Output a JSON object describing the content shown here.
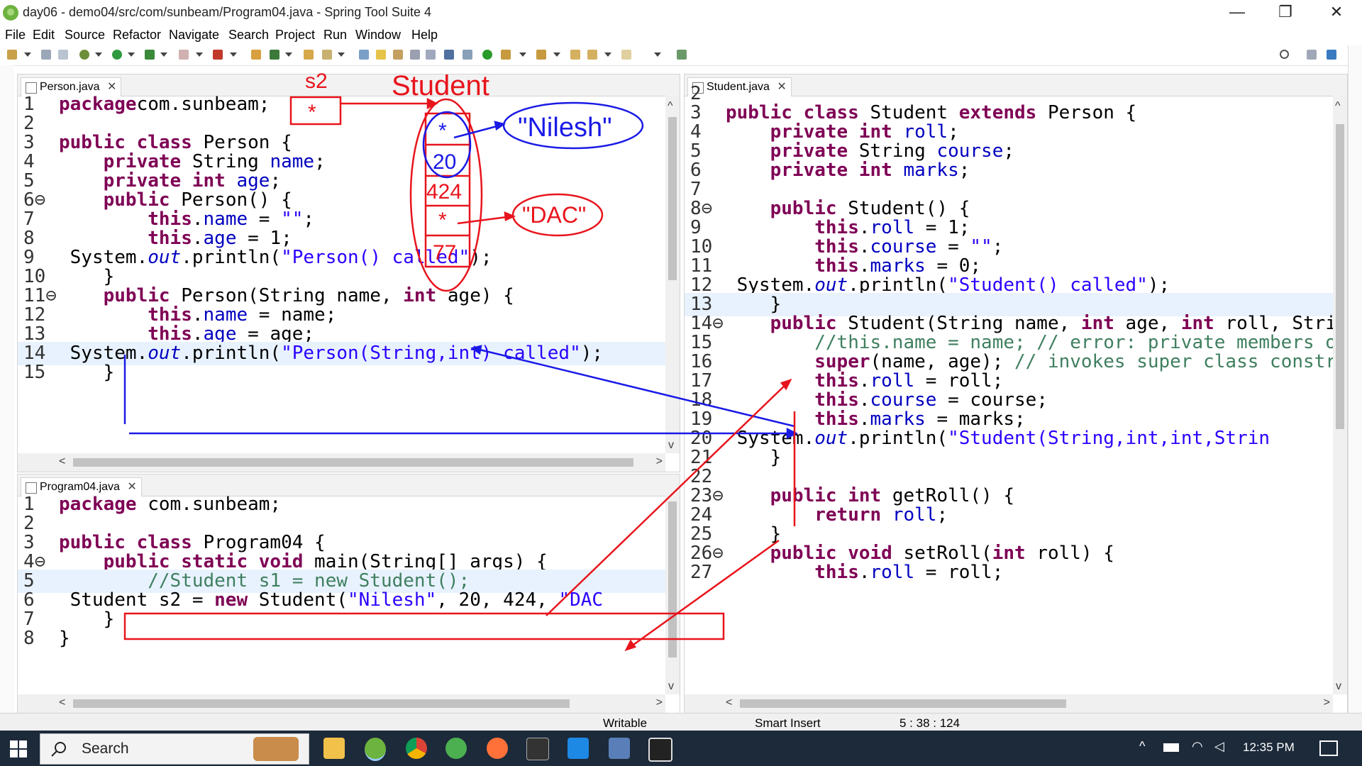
{
  "window": {
    "title": "day06 - demo04/src/com/sunbeam/Program04.java - Spring Tool Suite 4",
    "minimize": "—",
    "maximize": "❐",
    "close": "✕"
  },
  "menu": [
    "File",
    "Edit",
    "Source",
    "Refactor",
    "Navigate",
    "Search",
    "Project",
    "Run",
    "Window",
    "Help"
  ],
  "editors": {
    "person": {
      "tab": "Person.java",
      "close": "✕",
      "lines": [
        {
          "n": "1",
          "t": [
            [
              "kw",
              "package"
            ],
            [
              "",
              "com.sunbeam;"
            ]
          ]
        },
        {
          "n": "2",
          "t": []
        },
        {
          "n": "3",
          "t": [
            [
              "kw",
              "public class"
            ],
            [
              "",
              " Person {"
            ]
          ]
        },
        {
          "n": "4",
          "t": [
            [
              "",
              " "
            ],
            [
              "kw",
              "private"
            ],
            [
              "",
              " String "
            ],
            [
              "fld",
              "name"
            ],
            [
              "",
              ";"
            ]
          ]
        },
        {
          "n": "5",
          "t": [
            [
              "",
              " "
            ],
            [
              "kw",
              "private int"
            ],
            [
              "",
              " "
            ],
            [
              "fld",
              "age"
            ],
            [
              "",
              ";"
            ]
          ]
        },
        {
          "n": "6⊖",
          "t": [
            [
              "",
              " "
            ],
            [
              "kw",
              "public"
            ],
            [
              "",
              " Person() {"
            ]
          ]
        },
        {
          "n": "7",
          "t": [
            [
              "",
              " "
            ],
            [
              "kw",
              "this"
            ],
            [
              "",
              "."
            ],
            [
              "fld",
              "name"
            ],
            [
              "",
              " = "
            ],
            [
              "str",
              "\"\""
            ],
            [
              "",
              ";"
            ]
          ]
        },
        {
          "n": "8",
          "t": [
            [
              "",
              " "
            ],
            [
              "kw",
              "this"
            ],
            [
              "",
              "."
            ],
            [
              "fld",
              "age"
            ],
            [
              "",
              " = 1;"
            ]
          ]
        },
        {
          "n": "9",
          "t": [
            [
              "",
              " System."
            ],
            [
              "ital",
              "out"
            ],
            [
              "",
              ".println("
            ],
            [
              "str",
              "\"Person() called\""
            ],
            [
              "",
              ");"
            ]
          ]
        },
        {
          "n": "10",
          "t": [
            [
              "",
              "    }"
            ]
          ]
        },
        {
          "n": "11⊖",
          "t": [
            [
              "",
              " "
            ],
            [
              "kw",
              "public"
            ],
            [
              "",
              " Person(String name, "
            ],
            [
              "kw",
              "int"
            ],
            [
              "",
              " age) {"
            ]
          ]
        },
        {
          "n": "12",
          "t": [
            [
              "",
              " "
            ],
            [
              "kw",
              "this"
            ],
            [
              "",
              "."
            ],
            [
              "fld",
              "name"
            ],
            [
              "",
              " = name;"
            ]
          ]
        },
        {
          "n": "13",
          "t": [
            [
              "",
              " "
            ],
            [
              "kw",
              "this"
            ],
            [
              "",
              "."
            ],
            [
              "fld",
              "age"
            ],
            [
              "",
              " = age;"
            ]
          ]
        },
        {
          "n": "14",
          "t": [
            [
              "",
              " System."
            ],
            [
              "ital",
              "out"
            ],
            [
              "",
              ".println("
            ],
            [
              "str",
              "\"Person(String,int) called\""
            ],
            [
              "",
              ");"
            ]
          ]
        },
        {
          "n": "15",
          "t": [
            [
              "",
              "    }"
            ]
          ]
        }
      ]
    },
    "program": {
      "tab": "Program04.java",
      "close": "✕",
      "lines": [
        {
          "n": "1",
          "t": [
            [
              "kw",
              "package"
            ],
            [
              "",
              " com.sunbeam;"
            ]
          ]
        },
        {
          "n": "2",
          "t": []
        },
        {
          "n": "3",
          "t": [
            [
              "kw",
              "public class"
            ],
            [
              "",
              " Program04 {"
            ]
          ]
        },
        {
          "n": "4⊖",
          "t": [
            [
              "",
              " "
            ],
            [
              "kw",
              "public static void"
            ],
            [
              "",
              " main(String[] args) {"
            ]
          ]
        },
        {
          "n": "5",
          "t": [
            [
              "",
              " "
            ],
            [
              "com",
              "//Student s1 = new Student();"
            ]
          ]
        },
        {
          "n": "6",
          "t": [
            [
              "",
              " Student s2 = "
            ],
            [
              "kw",
              "new"
            ],
            [
              "",
              " Student("
            ],
            [
              "str",
              "\"Nilesh\""
            ],
            [
              "",
              ", 20, 424, "
            ],
            [
              "str",
              "\"DAC"
            ]
          ]
        },
        {
          "n": "7",
          "t": [
            [
              "",
              "    }"
            ]
          ]
        },
        {
          "n": "8",
          "t": [
            [
              "",
              "}"
            ]
          ]
        }
      ]
    },
    "student": {
      "tab": "Student.java",
      "close": "✕",
      "lines": [
        {
          "n": "2",
          "t": []
        },
        {
          "n": "3",
          "t": [
            [
              "kw",
              "public class"
            ],
            [
              "",
              " Student "
            ],
            [
              "kw",
              "extends"
            ],
            [
              "",
              " Person {"
            ]
          ]
        },
        {
          "n": "4",
          "t": [
            [
              "",
              " "
            ],
            [
              "kw",
              "private int"
            ],
            [
              "",
              " "
            ],
            [
              "fld",
              "roll"
            ],
            [
              "",
              ";"
            ]
          ]
        },
        {
          "n": "5",
          "t": [
            [
              "",
              " "
            ],
            [
              "kw",
              "private"
            ],
            [
              "",
              " String "
            ],
            [
              "fld",
              "course"
            ],
            [
              "",
              ";"
            ]
          ]
        },
        {
          "n": "6",
          "t": [
            [
              "",
              " "
            ],
            [
              "kw",
              "private int"
            ],
            [
              "",
              " "
            ],
            [
              "fld",
              "marks"
            ],
            [
              "",
              ";"
            ]
          ]
        },
        {
          "n": "7",
          "t": []
        },
        {
          "n": "8⊖",
          "t": [
            [
              "",
              " "
            ],
            [
              "kw",
              "public"
            ],
            [
              "",
              " Student() {"
            ]
          ]
        },
        {
          "n": "9",
          "t": [
            [
              "",
              " "
            ],
            [
              "kw",
              "this"
            ],
            [
              "",
              "."
            ],
            [
              "fld",
              "roll"
            ],
            [
              "",
              " = 1;"
            ]
          ]
        },
        {
          "n": "10",
          "t": [
            [
              "",
              " "
            ],
            [
              "kw",
              "this"
            ],
            [
              "",
              "."
            ],
            [
              "fld",
              "course"
            ],
            [
              "",
              " = "
            ],
            [
              "str",
              "\"\""
            ],
            [
              "",
              ";"
            ]
          ]
        },
        {
          "n": "11",
          "t": [
            [
              "",
              " "
            ],
            [
              "kw",
              "this"
            ],
            [
              "",
              "."
            ],
            [
              "fld",
              "marks"
            ],
            [
              "",
              " = 0;"
            ]
          ]
        },
        {
          "n": "12",
          "t": [
            [
              "",
              " System."
            ],
            [
              "ital",
              "out"
            ],
            [
              "",
              ".println("
            ],
            [
              "str",
              "\"Student() called\""
            ],
            [
              "",
              ");"
            ]
          ]
        },
        {
          "n": "13",
          "t": [
            [
              "",
              "    }"
            ]
          ]
        },
        {
          "n": "14⊖",
          "t": [
            [
              "",
              " "
            ],
            [
              "kw",
              "public"
            ],
            [
              "",
              " Student(String name, "
            ],
            [
              "kw",
              "int"
            ],
            [
              "",
              " age, "
            ],
            [
              "kw",
              "int"
            ],
            [
              "",
              " roll, Strin"
            ]
          ]
        },
        {
          "n": "15",
          "t": [
            [
              "",
              " "
            ],
            [
              "com",
              "//this.name = name; // error: private members of"
            ]
          ]
        },
        {
          "n": "16",
          "t": [
            [
              "",
              " "
            ],
            [
              "kw",
              "super"
            ],
            [
              "",
              "(name, age); "
            ],
            [
              "com",
              "// invokes super class constru"
            ]
          ]
        },
        {
          "n": "17",
          "t": [
            [
              "",
              " "
            ],
            [
              "kw",
              "this"
            ],
            [
              "",
              "."
            ],
            [
              "fld",
              "roll"
            ],
            [
              "",
              " = roll;"
            ]
          ]
        },
        {
          "n": "18",
          "t": [
            [
              "",
              " "
            ],
            [
              "kw",
              "this"
            ],
            [
              "",
              "."
            ],
            [
              "fld",
              "course"
            ],
            [
              "",
              " = course;"
            ]
          ]
        },
        {
          "n": "19",
          "t": [
            [
              "",
              " "
            ],
            [
              "kw",
              "this"
            ],
            [
              "",
              "."
            ],
            [
              "fld",
              "marks"
            ],
            [
              "",
              " = marks;"
            ]
          ]
        },
        {
          "n": "20",
          "t": [
            [
              "",
              " System."
            ],
            [
              "ital",
              "out"
            ],
            [
              "",
              ".println("
            ],
            [
              "str",
              "\"Student(String,int,int,Strin"
            ]
          ]
        },
        {
          "n": "21",
          "t": [
            [
              "",
              "    }"
            ]
          ]
        },
        {
          "n": "22",
          "t": []
        },
        {
          "n": "23⊖",
          "t": [
            [
              "",
              " "
            ],
            [
              "kw",
              "public int"
            ],
            [
              "",
              " getRoll() {"
            ]
          ]
        },
        {
          "n": "24",
          "t": [
            [
              "",
              " "
            ],
            [
              "kw",
              "return"
            ],
            [
              "",
              " "
            ],
            [
              "fld",
              "roll"
            ],
            [
              "",
              ";"
            ]
          ]
        },
        {
          "n": "25",
          "t": [
            [
              "",
              "    }"
            ]
          ]
        },
        {
          "n": "26⊖",
          "t": [
            [
              "",
              " "
            ],
            [
              "kw",
              "public void"
            ],
            [
              "",
              " setRoll("
            ],
            [
              "kw",
              "int"
            ],
            [
              "",
              " roll) {"
            ]
          ]
        },
        {
          "n": "27",
          "t": [
            [
              "",
              " "
            ],
            [
              "kw",
              "this"
            ],
            [
              "",
              "."
            ],
            [
              "fld",
              "roll"
            ],
            [
              "",
              " = roll;"
            ]
          ]
        }
      ]
    }
  },
  "status": {
    "mode": "Writable",
    "insert": "Smart Insert",
    "position": "5 : 38 : 124"
  },
  "taskbar": {
    "search": "Search",
    "clock": "12:35 PM"
  },
  "annotations": {
    "s2_label": "s2",
    "s2_value": "*",
    "object_label": "Student",
    "fields": [
      "*",
      "20",
      "424",
      "*",
      "77"
    ],
    "name_value": "\"Nilesh\"",
    "course_value": "\"DAC\"",
    "colors": {
      "red": "#e8141c",
      "blue": "#1a1ae6"
    }
  }
}
